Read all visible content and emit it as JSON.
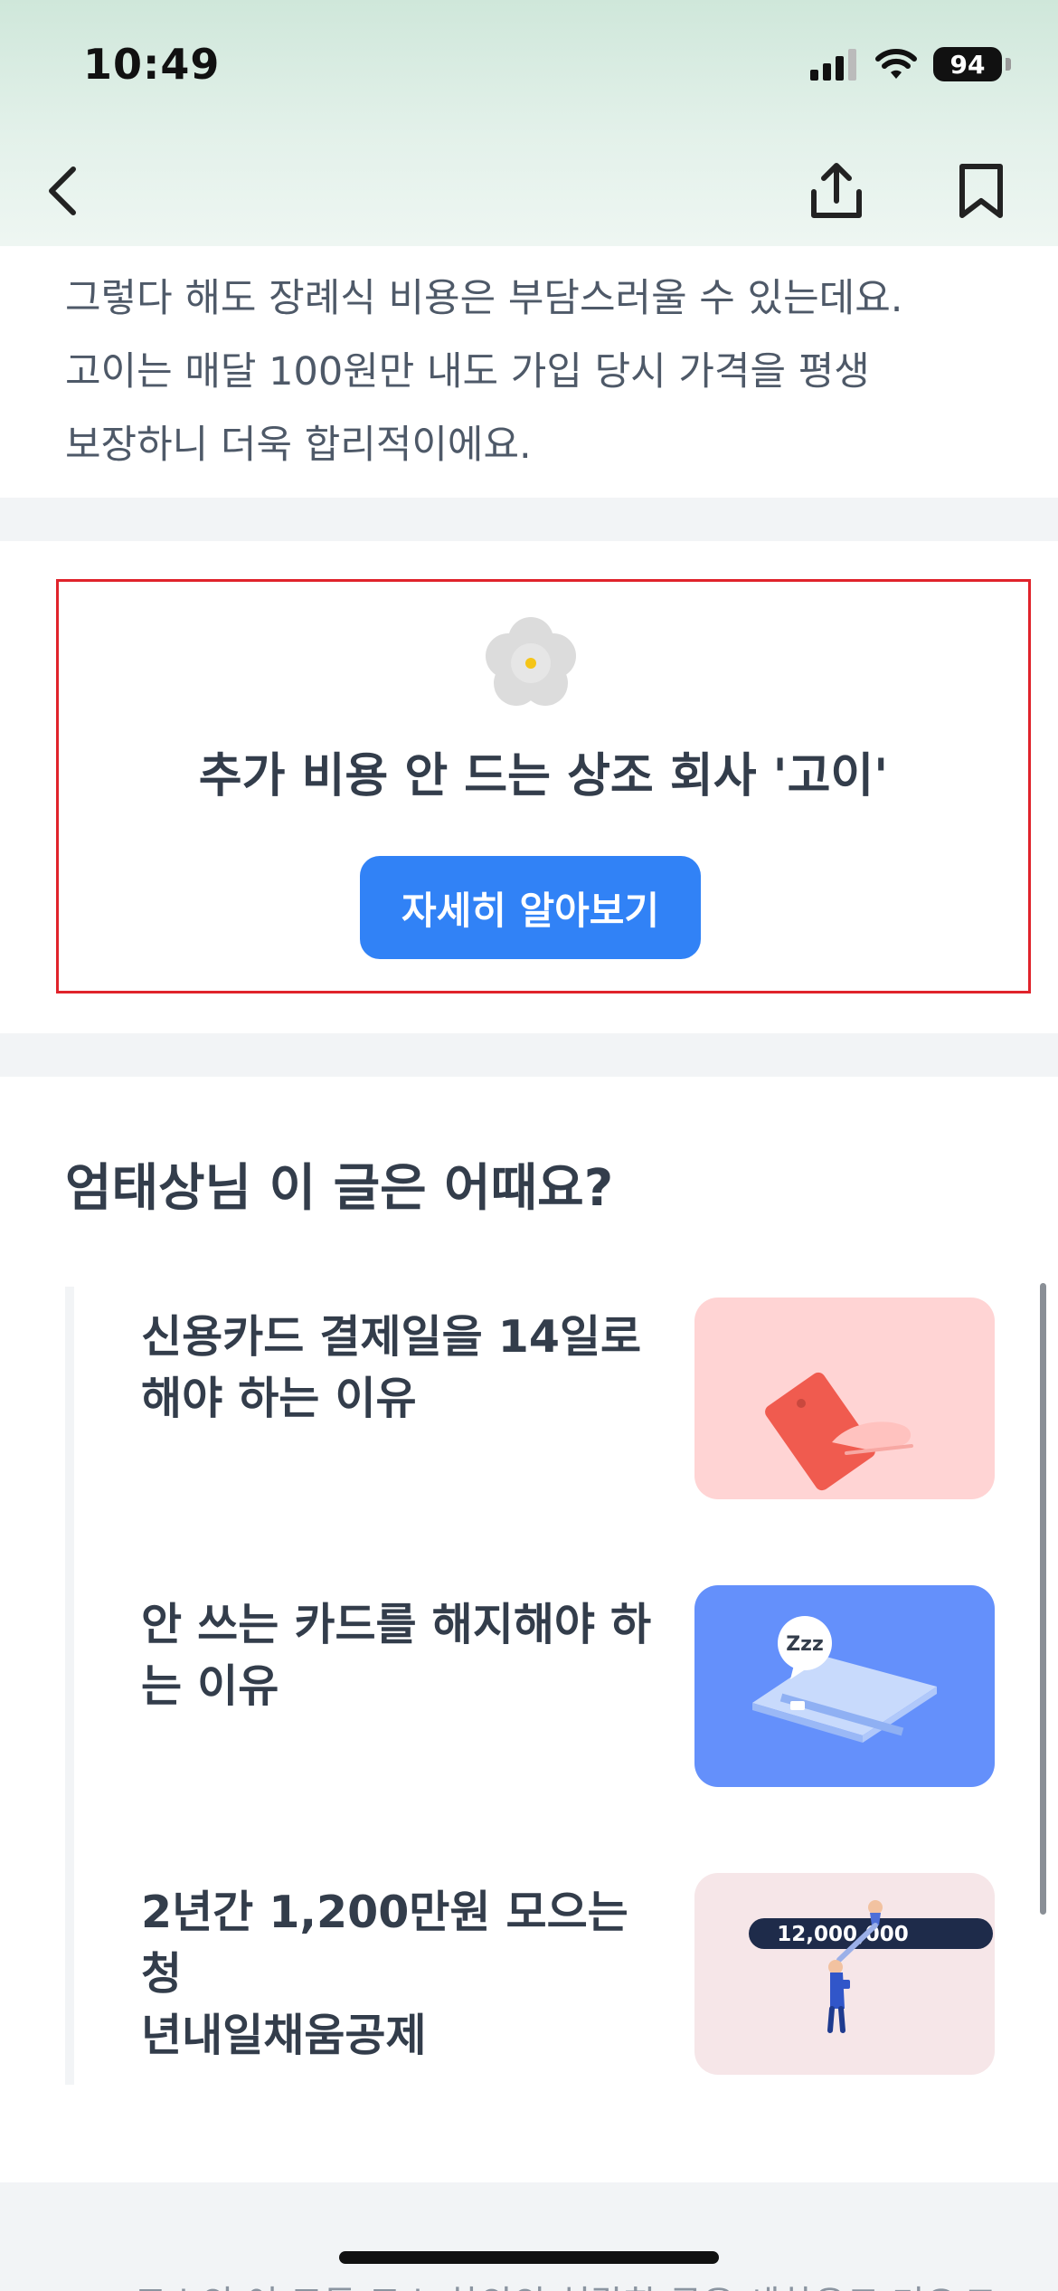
{
  "status_bar": {
    "time": "10:49",
    "battery": "94"
  },
  "nav": {
    "back": "back",
    "share": "share",
    "bookmark": "bookmark"
  },
  "article": {
    "lines": [
      "그렇다 해도 장례식 비용은 부담스러울 수 있는데요.",
      "고이는 매달 100원만 내도 가입 당시 가격을 평생",
      "보장하니 더욱 합리적이에요."
    ]
  },
  "promo": {
    "icon": "flower-icon",
    "title": "추가 비용 안 드는 상조 회사 '고이'",
    "button_label": "자세히 알아보기"
  },
  "recommendations": {
    "title": "엄태상님 이 글은 어때요?",
    "items": [
      {
        "line1": "신용카드 결제일을 14일로",
        "line2": "해야 하는 이유",
        "thumb_color": "#ffd4d4",
        "icon": "card-in-hand-icon"
      },
      {
        "line1": "안 쓰는 카드를 해지해야 하",
        "line2": "는 이유",
        "thumb_color": "#6490fb",
        "icon": "sleeping-card-icon",
        "badge": "Zzz"
      },
      {
        "line1": "2년간 1,200만원 모으는 청",
        "line2": "년내일채움공제",
        "thumb_color": "#f6e6e8",
        "icon": "savings-climb-icon",
        "badge": "12,000,000"
      }
    ]
  },
  "footer": {
    "text": "토스의 이 모든 토스 하의의 처랍한 금은 세하우드 기오 T"
  }
}
